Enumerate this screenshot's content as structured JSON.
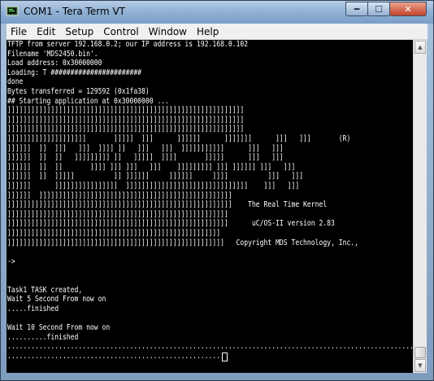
{
  "window": {
    "title": "COM1 - Tera Term VT"
  },
  "titlebar_buttons": {
    "minimize": "━",
    "maximize": "☐",
    "close": "✕"
  },
  "menu": [
    "File",
    "Edit",
    "Setup",
    "Control",
    "Window",
    "Help"
  ],
  "terminal": {
    "lines": [
      "TFTP from server 192.168.0.2; our IP address is 192.168.0.102",
      "Filename 'MDS2450.bin'.",
      "Load address: 0x30000000",
      "Loading: T #######################",
      "done",
      "Bytes transferred = 129592 (0x1fa38)",
      "## Starting application at 0x30000000 ...",
      "]]]]]]]]]]]]]]]]]]]]]]]]]]]]]]]]]]]]]]]]]]]]]]]]]]]]]]]]]]]]",
      "]]]]]]]]]]]]]]]]]]]]]]]]]]]]]]]]]]]]]]]]]]]]]]]]]]]]]]]]]]]]",
      "]]]]]]]]]]]]]]]]]]]]]]]]]]]]]]]]]]]]]]]]]]]]]]]]]]]]]]]]]]]]",
      "]]]]]]]]]]]]]]]]]]]]       ]]]]]  ]]]      ]]]]]]      ]]]]]]]      ]]]   ]]]       (R)",
      "]]]]]]  ]]  ]]]   ]]]  ]]]] ]]   ]]]   ]]]  ]]]]]]]]]]]      ]]]   ]]]",
      "]]]]]]  ]]  ]]   ]]]]]]]]] ]]   ]]]]]  ]]]]       ]]]]]      ]]]   ]]]",
      "]]]]]]  ]]  ]]       ]]]] ]]] ]]]   ]]]    ]]]]]]]]] ]]] ]]]]]] ]]]   ]]]",
      "]]]]]]  ]]  ]]]]]          ]] ]]]]]]     ]]]]]]     ]]]]          ]]]   ]]]",
      "]]]]]]      ]]]]]]]]]]]]]]]]  ]]]]]]]]]]]]]]]]]]]]]]]]]]]]]]]    ]]]   ]]]",
      "]]]]]]  ]]]]]]]]]]]]]]]]]]]]]]]]]]]]]]]]]]]]]]]]]]]]]]]]]",
      "]]]]]]]]]]]]]]]]]]]]]]]]]]]]]]]]]]]]]]]]]]]]]]]]]]]]]]]]]    The Real Time Kernel",
      "]]]]]]]]]]]]]]]]]]]]]]]]]]]]]]]]]]]]]]]]]]]]]]]]]]]]]]]]",
      "]]]]]]]]]]]]]]]]]]]]]]]]]]]]]]]]]]]]]]]]]]]]]]]]]]]]]]]]      uC/OS-II version 2.83",
      "]]]]]]]]]]]]]]]]]]]]]]]]]]]]]]]]]]]]]]]]]]]]]]]]]]]]]]",
      "]]]]]]]]]]]]]]]]]]]]]]]]]]]]]]]]]]]]]]]]]]]]]]]]]]]]]]]   Copyright MDS Technology, Inc.,",
      "",
      "->",
      "",
      "",
      "Task1 TASK created,",
      "Wait 5 Second From now on",
      ".....finished",
      "",
      "Wait 10 Second From now on",
      "..........finished",
      "....................................................................................................................",
      "......................................................"
    ]
  }
}
